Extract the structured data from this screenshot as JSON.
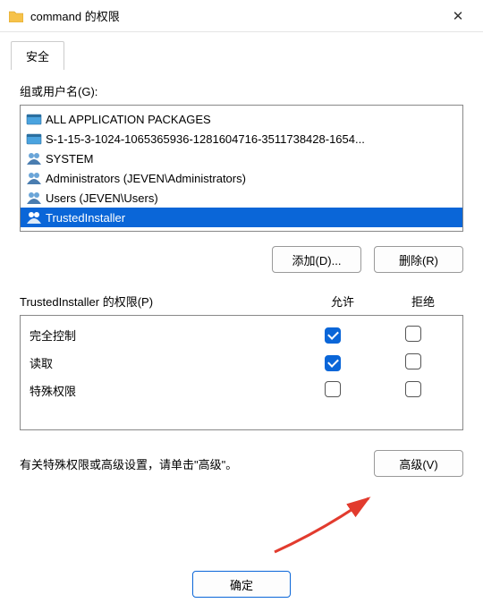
{
  "titlebar": {
    "title": "command 的权限"
  },
  "tabs": {
    "security": "安全"
  },
  "labels": {
    "group_or_users": "组或用户名(G):",
    "permissions_for": "TrustedInstaller 的权限(P)",
    "allow": "允许",
    "deny": "拒绝",
    "advanced_hint": "有关特殊权限或高级设置，请单击\"高级\"。"
  },
  "principals": [
    {
      "name": "ALL APPLICATION PACKAGES",
      "icon": "package",
      "selected": false
    },
    {
      "name": "S-1-15-3-1024-1065365936-1281604716-3511738428-1654...",
      "icon": "package",
      "selected": false
    },
    {
      "name": "SYSTEM",
      "icon": "group",
      "selected": false
    },
    {
      "name": "Administrators (JEVEN\\Administrators)",
      "icon": "group",
      "selected": false
    },
    {
      "name": "Users (JEVEN\\Users)",
      "icon": "group",
      "selected": false
    },
    {
      "name": "TrustedInstaller",
      "icon": "group",
      "selected": true
    }
  ],
  "buttons": {
    "add": "添加(D)...",
    "remove": "删除(R)",
    "advanced": "高级(V)",
    "ok": "确定"
  },
  "permissions": [
    {
      "label": "完全控制",
      "allow": true,
      "deny": false
    },
    {
      "label": "读取",
      "allow": true,
      "deny": false
    },
    {
      "label": "特殊权限",
      "allow": false,
      "deny": false
    }
  ]
}
